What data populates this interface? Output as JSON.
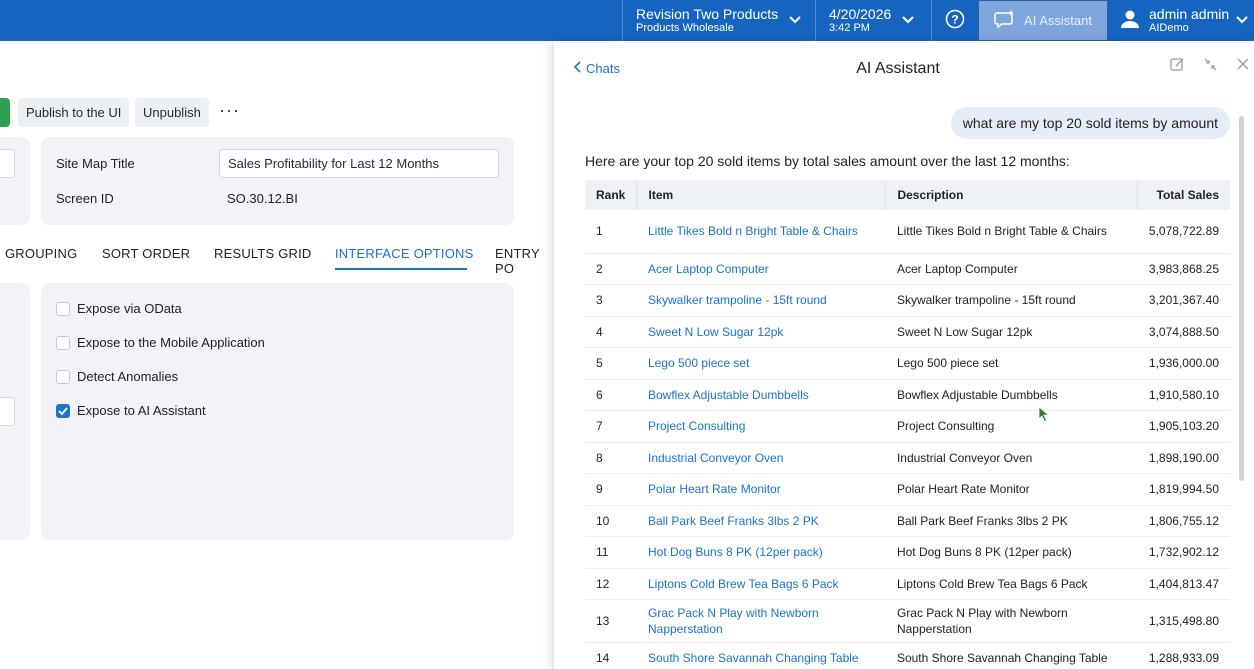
{
  "topbar": {
    "company_name": "Revision Two Products",
    "company_branch": "Products Wholesale",
    "date": "4/20/2026",
    "time": "3:42 PM",
    "ai_assistant_label": "AI Assistant",
    "user_name": "admin admin",
    "user_tenant": "AIDemo"
  },
  "toolbar": {
    "publish_label": "Publish to the UI",
    "unpublish_label": "Unpublish",
    "more_label": "···"
  },
  "form": {
    "site_map_title_label": "Site Map Title",
    "site_map_title_value": "Sales Profitability for Last 12 Months",
    "screen_id_label": "Screen ID",
    "screen_id_value": "SO.30.12.BI"
  },
  "tabs": [
    "GROUPING",
    "SORT ORDER",
    "RESULTS GRID",
    "INTERFACE OPTIONS",
    "ENTRY PO"
  ],
  "interface_options": [
    {
      "label": "Expose via OData",
      "checked": false
    },
    {
      "label": "Expose to the Mobile Application",
      "checked": false
    },
    {
      "label": "Detect Anomalies",
      "checked": false
    },
    {
      "label": "Expose to AI Assistant",
      "checked": true
    }
  ],
  "panel": {
    "back_label": "Chats",
    "title": "AI Assistant",
    "user_message": "what are my top 20 sold items by amount",
    "answer_intro": "Here are your top 20 sold items by total sales amount over the last 12 months:",
    "columns": [
      "Rank",
      "Item",
      "Description",
      "Total Sales"
    ],
    "rows": [
      {
        "rank": "1",
        "item": "Little Tikes Bold n Bright Table & Chairs",
        "description": "Little Tikes Bold n Bright Table & Chairs",
        "total": "5,078,722.89"
      },
      {
        "rank": "2",
        "item": "Acer Laptop Computer",
        "description": "Acer Laptop Computer",
        "total": "3,983,868.25"
      },
      {
        "rank": "3",
        "item": "Skywalker trampoline - 15ft round",
        "description": "Skywalker trampoline - 15ft round",
        "total": "3,201,367.40"
      },
      {
        "rank": "4",
        "item": "Sweet N Low Sugar 12pk",
        "description": "Sweet N Low Sugar 12pk",
        "total": "3,074,888.50"
      },
      {
        "rank": "5",
        "item": "Lego 500 piece set",
        "description": "Lego 500 piece set",
        "total": "1,936,000.00"
      },
      {
        "rank": "6",
        "item": "Bowflex Adjustable Dumbbells",
        "description": "Bowflex Adjustable Dumbbells",
        "total": "1,910,580.10"
      },
      {
        "rank": "7",
        "item": "Project Consulting",
        "description": "Project Consulting",
        "total": "1,905,103.20"
      },
      {
        "rank": "8",
        "item": "Industrial Conveyor Oven",
        "description": "Industrial Conveyor Oven",
        "total": "1,898,190.00"
      },
      {
        "rank": "9",
        "item": "Polar Heart Rate Monitor",
        "description": "Polar Heart Rate Monitor",
        "total": "1,819,994.50"
      },
      {
        "rank": "10",
        "item": "Ball Park Beef Franks 3lbs 2 PK",
        "description": "Ball Park Beef Franks 3lbs 2 PK",
        "total": "1,806,755.12"
      },
      {
        "rank": "11",
        "item": "Hot Dog Buns 8 PK (12per pack)",
        "description": "Hot Dog Buns 8 PK (12per pack)",
        "total": "1,732,902.12"
      },
      {
        "rank": "12",
        "item": "Liptons Cold Brew Tea Bags 6 Pack",
        "description": "Liptons Cold Brew Tea Bags 6 Pack",
        "total": "1,404,813.47"
      },
      {
        "rank": "13",
        "item": "Grac Pack N Play with Newborn Napperstation",
        "description": "Grac Pack N Play with Newborn Napperstation",
        "total": "1,315,498.80"
      },
      {
        "rank": "14",
        "item": "South Shore Savannah Changing Table",
        "description": "South Shore Savannah Changing Table",
        "total": "1,288,933.09"
      }
    ]
  },
  "colors": {
    "topbar": "#1565c0",
    "link": "#1a73c8",
    "publish_green": "#2e9e4f"
  }
}
